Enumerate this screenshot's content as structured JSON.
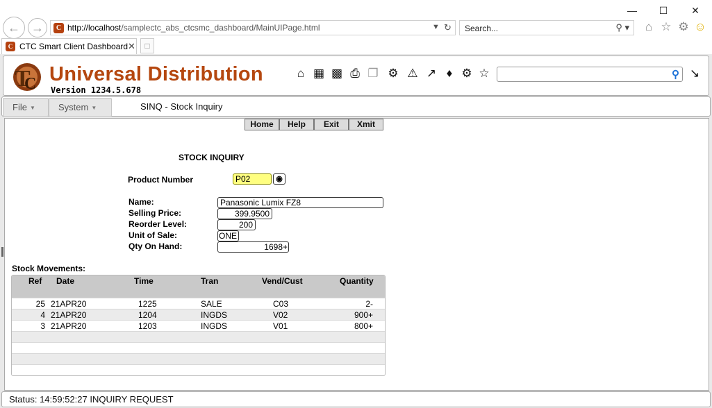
{
  "browser": {
    "url_host": "http://localhost",
    "url_path": "/samplectc_abs_ctcsmc_dashboard/MainUIPage.html",
    "search_placeholder": "Search...",
    "tab_title": "CTC Smart Client Dashboard"
  },
  "header": {
    "brand": "Universal Distribution",
    "version": "Version 1234.5.678",
    "search_value": ""
  },
  "menu": {
    "file": "File",
    "system": "System",
    "screen_title": "SINQ - Stock Inquiry"
  },
  "actions": {
    "home": "Home",
    "help": "Help",
    "exit": "Exit",
    "xmit": "Xmit"
  },
  "form": {
    "title": "STOCK INQUIRY",
    "product_number_label": "Product Number",
    "product_number": "P02",
    "name_label": "Name:",
    "name": "Panasonic Lumix FZ8",
    "selling_price_label": "Selling Price:",
    "selling_price": "399.9500",
    "reorder_level_label": "Reorder Level:",
    "reorder_level": "200",
    "unit_of_sale_label": "Unit of Sale:",
    "unit_of_sale": "ONE",
    "qty_on_hand_label": "Qty On Hand:",
    "qty_on_hand": "1698+"
  },
  "movements": {
    "label": "Stock Movements:",
    "columns": [
      "Ref",
      "Date",
      "Time",
      "Tran",
      "Vend/Cust",
      "Quantity"
    ],
    "rows": [
      [
        "25",
        "21APR20",
        "1225",
        "SALE",
        "C03",
        "2-"
      ],
      [
        "4",
        "21APR20",
        "1204",
        "INGDS",
        "V02",
        "900+"
      ],
      [
        "3",
        "21APR20",
        "1203",
        "INGDS",
        "V01",
        "800+"
      ]
    ]
  },
  "status": {
    "text": "Status: 14:59:52:27 INQUIRY REQUEST"
  },
  "colors": {
    "brand": "#b5470f",
    "field_highlight": "#ffff80",
    "grid_header": "#c9c9c9"
  },
  "icons": [
    "back-icon",
    "forward-icon",
    "refresh-icon",
    "home-icon",
    "calendar-icon",
    "calculator-icon",
    "print-icon",
    "copy-icon",
    "cogs-icon",
    "warning-icon",
    "external-link-icon",
    "tag-icon",
    "gear-icon",
    "star-icon",
    "search-icon",
    "collapse-icon",
    "binoculars-icon"
  ]
}
